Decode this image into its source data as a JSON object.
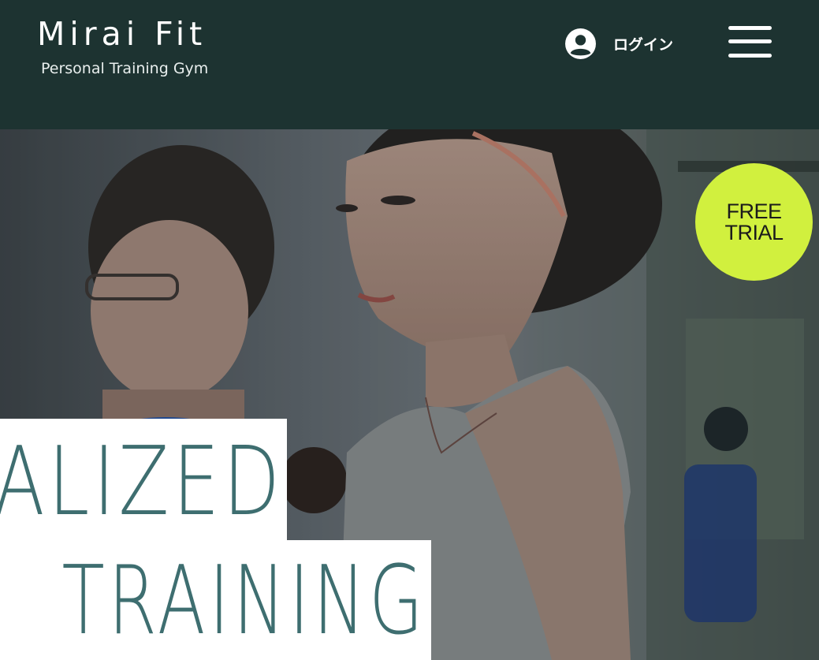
{
  "header": {
    "brand_name": "Mirai Fit",
    "tagline": "Personal Training Gym",
    "login_label": "ログイン",
    "login_icon": "user-circle-icon",
    "menu_icon": "hamburger-menu-icon"
  },
  "hero": {
    "badge": {
      "line1": "FREE",
      "line2": "TRIAL"
    },
    "headline_line1": "ALIZED",
    "headline_line2": "TRAINING"
  },
  "colors": {
    "header_bg": "#1d3331",
    "badge_bg": "#d1f03e",
    "headline_text": "#3e6e70",
    "headline_box": "#ffffff"
  }
}
